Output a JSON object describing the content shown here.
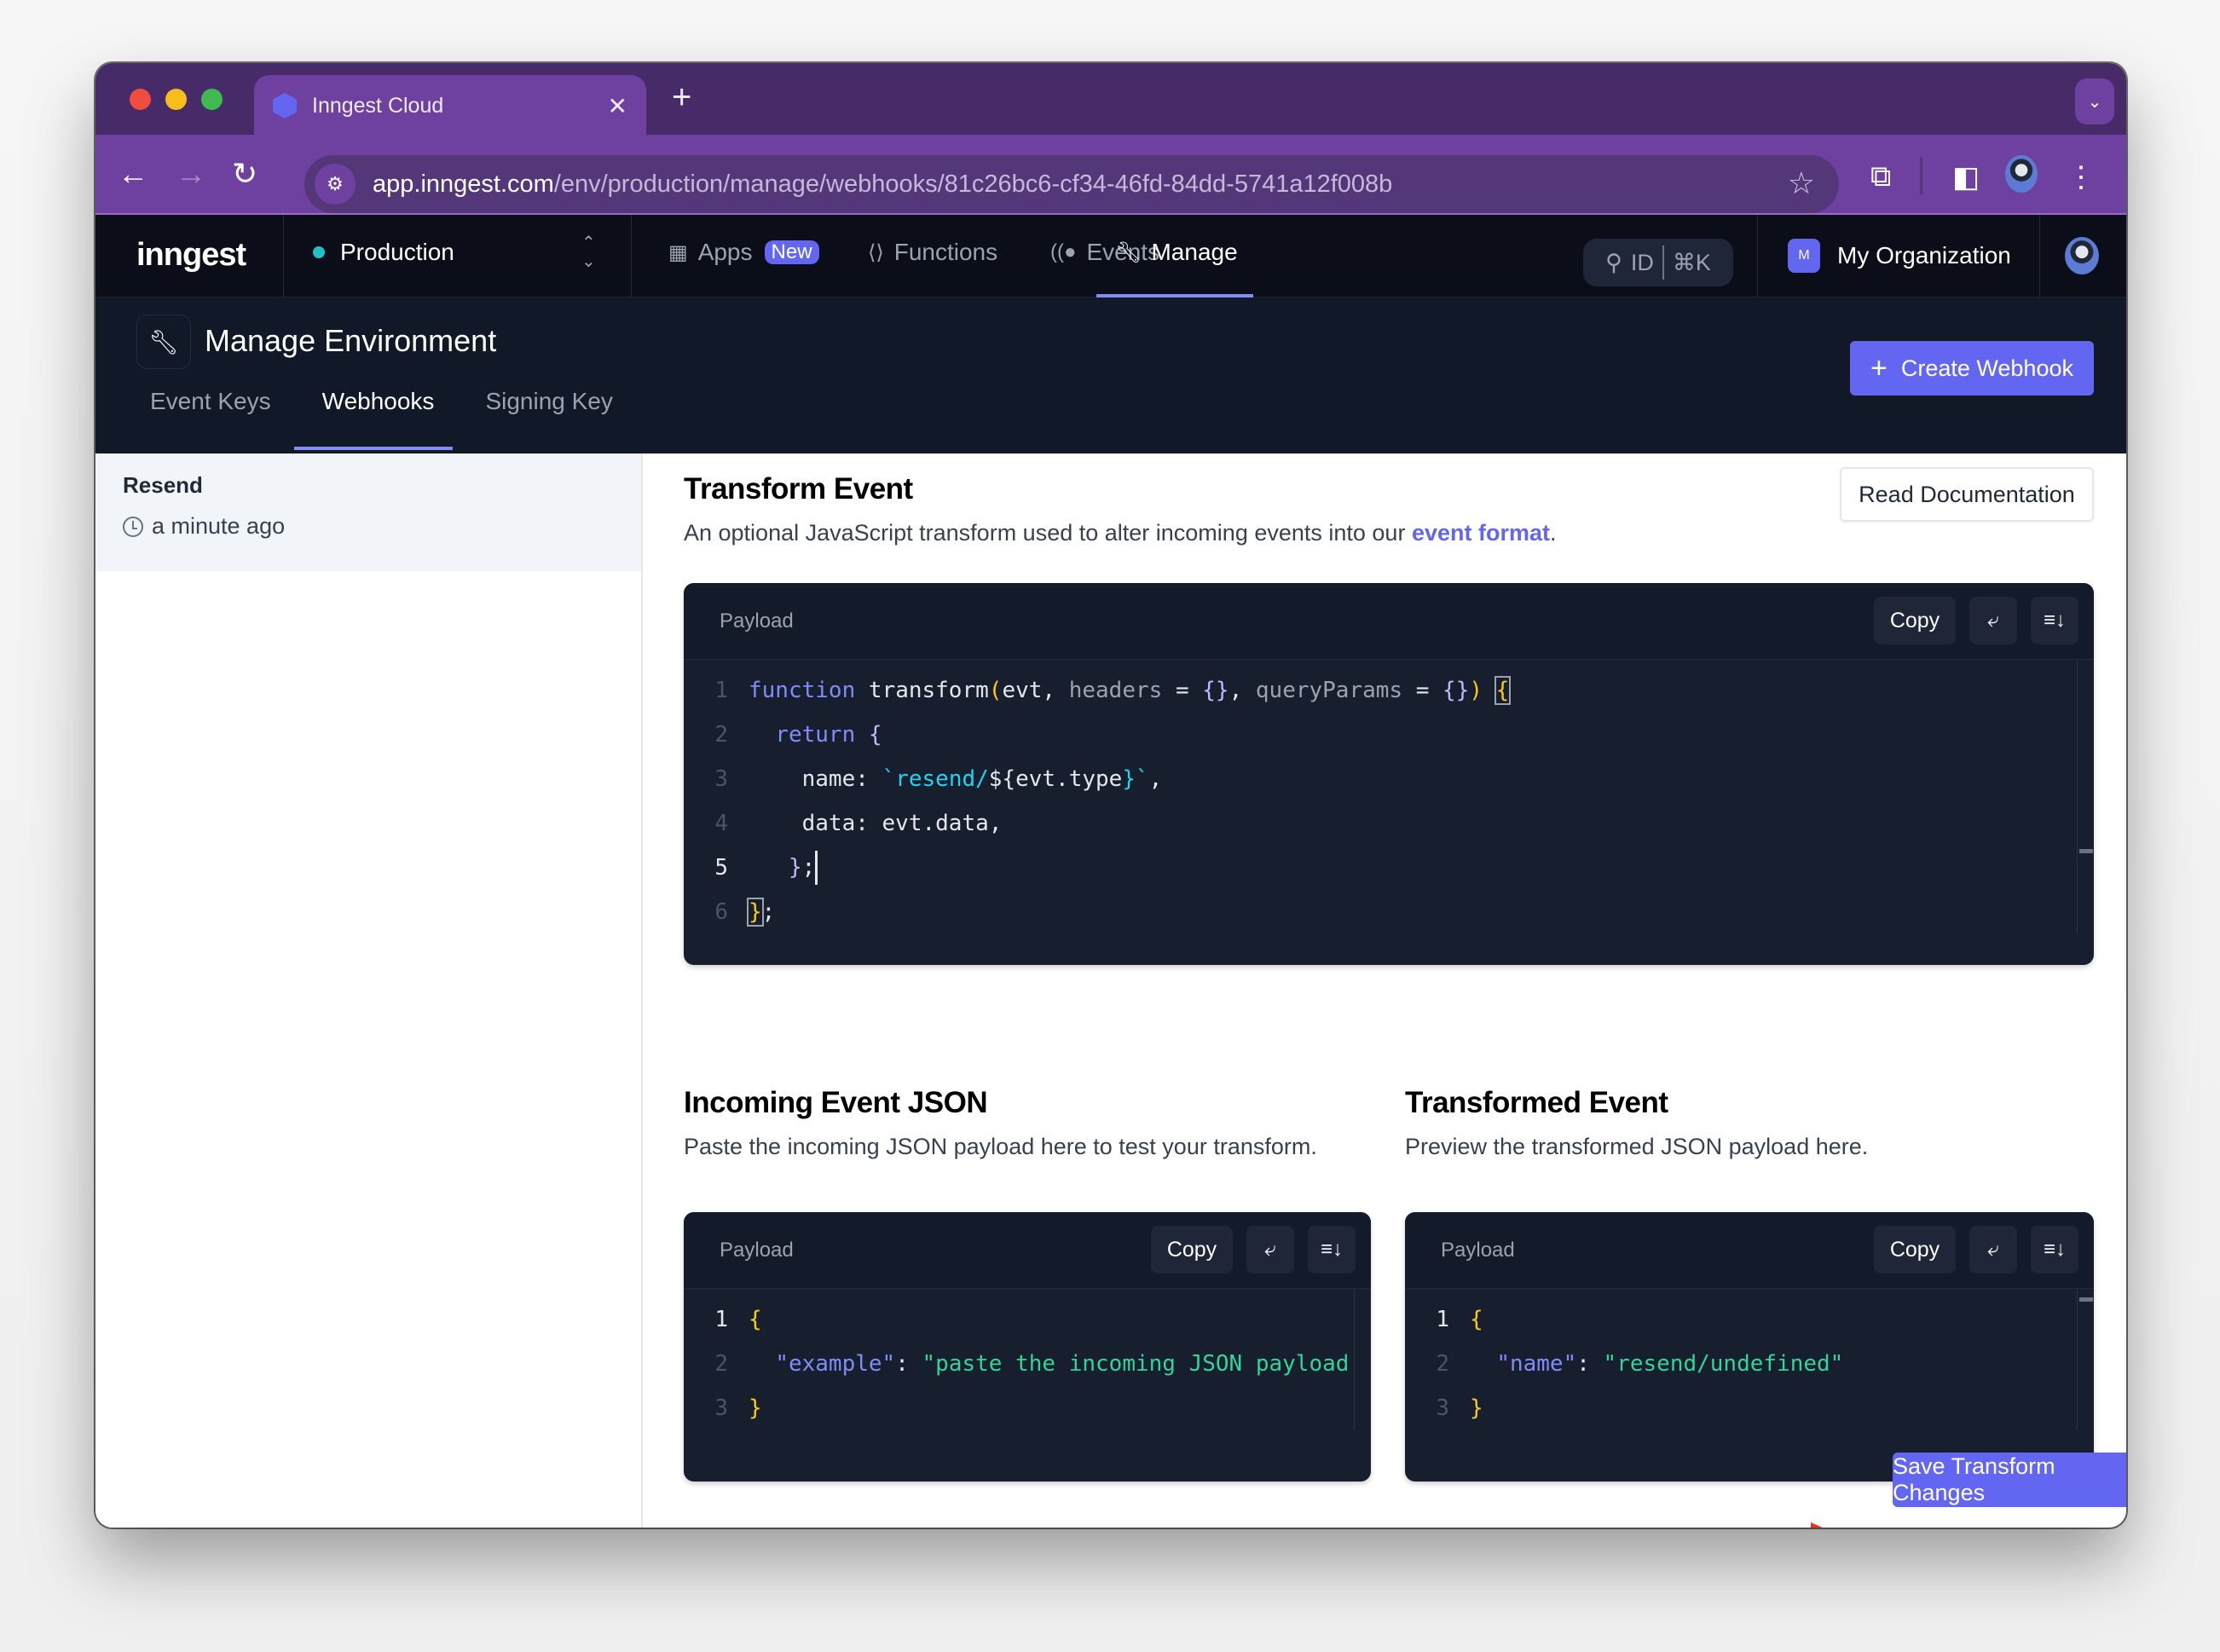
{
  "browser": {
    "tab_title": "Inngest Cloud",
    "new_tab_label": "+",
    "url_host": "app.inngest.com",
    "url_path": "/env/production/manage/webhooks/81c26bc6-cf34-46fd-84dd-5741a12f008b"
  },
  "header": {
    "logo": "inngest",
    "environment": "Production",
    "nav": [
      {
        "label": "Apps",
        "badge": "New",
        "icon": "grid-icon"
      },
      {
        "label": "Functions",
        "icon": "code-icon"
      },
      {
        "label": "Events",
        "icon": "signal-icon"
      },
      {
        "label": "Manage",
        "icon": "wrench-icon",
        "active": true
      }
    ],
    "search_label": "ID",
    "search_shortcut": "⌘K",
    "org_initial": "M",
    "org_name": "My Organization"
  },
  "page": {
    "title": "Manage Environment",
    "tabs": [
      {
        "label": "Event Keys"
      },
      {
        "label": "Webhooks",
        "active": true
      },
      {
        "label": "Signing Key"
      }
    ],
    "create_button": "Create Webhook"
  },
  "sidebar": {
    "items": [
      {
        "name": "Resend",
        "time": "a minute ago"
      }
    ]
  },
  "transform": {
    "title": "Transform Event",
    "desc_prefix": "An optional JavaScript transform used to alter incoming events into our ",
    "desc_link": "event format",
    "desc_suffix": ".",
    "doc_button": "Read Documentation",
    "editor_label": "Payload",
    "copy_label": "Copy",
    "lines": [
      "1",
      "2",
      "3",
      "4",
      "5",
      "6"
    ],
    "code": [
      "function transform(evt, headers = {}, queryParams = {}) {",
      "  return {",
      "    name: `resend/${evt.type}`,",
      "    data: evt.data,",
      "  };",
      "};"
    ],
    "current_line": 5
  },
  "incoming": {
    "title": "Incoming Event JSON",
    "desc": "Paste the incoming JSON payload here to test your transform.",
    "editor_label": "Payload",
    "copy_label": "Copy",
    "key": "\"example\"",
    "value": "\"paste the incoming JSON payload here\""
  },
  "transformed": {
    "title": "Transformed Event",
    "desc": "Preview the transformed JSON payload here.",
    "editor_label": "Payload",
    "copy_label": "Copy",
    "key": "\"name\"",
    "value": "\"resend/undefined\""
  },
  "save_button": "Save Transform Changes",
  "colors": {
    "accent": "#6366f1",
    "browser_chrome": "#6e41a0",
    "app_bg": "#0b0e19",
    "annotation_arrow": "#f0301a"
  }
}
